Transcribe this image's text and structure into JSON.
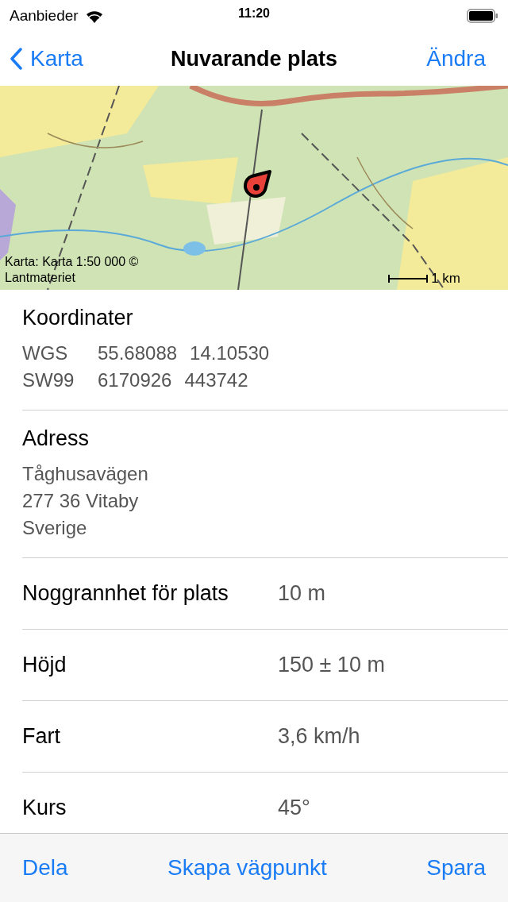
{
  "status_bar": {
    "carrier": "Aanbieder",
    "time": "11:20"
  },
  "nav": {
    "back": "Karta",
    "title": "Nuvarande plats",
    "action": "Ändra"
  },
  "map": {
    "kind": "picture",
    "attribution": "Karta: Karta 1:50 000 ©\nLantmateriet",
    "scale": "1 km"
  },
  "coordinates": {
    "title": "Koordinater",
    "rows": [
      {
        "system": "WGS",
        "values": [
          "55.68088",
          "14.10530"
        ]
      },
      {
        "system": "SW99",
        "values": [
          "6170926",
          "443742"
        ]
      }
    ]
  },
  "address": {
    "title": "Adress",
    "lines": [
      "Tåghusavägen",
      "277 36 Vitaby",
      "Sverige"
    ]
  },
  "details": [
    {
      "label": "Noggrannhet för plats",
      "value": "10 m"
    },
    {
      "label": "Höjd",
      "value": "150 ± 10 m"
    },
    {
      "label": "Fart",
      "value": "3,6 km/h"
    },
    {
      "label": "Kurs",
      "value": "45°"
    }
  ],
  "toolbar": [
    "Dela",
    "Skapa vägpunkt",
    "Spara"
  ]
}
